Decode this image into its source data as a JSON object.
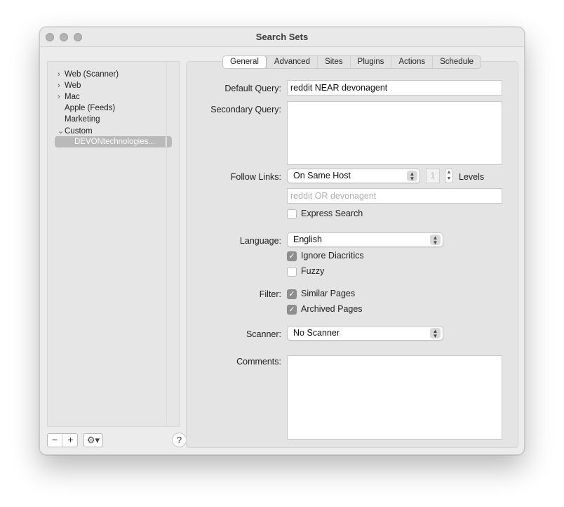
{
  "window": {
    "title": "Search Sets"
  },
  "sidebar": {
    "items": [
      {
        "label": "Web (Scanner)",
        "chevron": "›"
      },
      {
        "label": "Web",
        "chevron": "›"
      },
      {
        "label": "Mac",
        "chevron": "›"
      },
      {
        "label": "Apple (Feeds)",
        "chevron": ""
      },
      {
        "label": "Marketing",
        "chevron": ""
      },
      {
        "label": "Custom",
        "chevron": "⌄"
      }
    ],
    "selected": "DEVONtechnologies...",
    "buttons": {
      "minus": "−",
      "plus": "+",
      "gear": "⚙▾",
      "help": "?"
    }
  },
  "tabs": [
    "General",
    "Advanced",
    "Sites",
    "Plugins",
    "Actions",
    "Schedule"
  ],
  "form": {
    "default_query_label": "Default Query:",
    "default_query_value": "reddit NEAR devonagent",
    "secondary_query_label": "Secondary Query:",
    "follow_links_label": "Follow Links:",
    "follow_links_value": "On Same Host",
    "levels_value": "1",
    "levels_label": "Levels",
    "follow_filter_placeholder": "reddit OR devonagent",
    "express_search_label": "Express Search",
    "language_label": "Language:",
    "language_value": "English",
    "ignore_diacritics_label": "Ignore Diacritics",
    "fuzzy_label": "Fuzzy",
    "filter_label": "Filter:",
    "similar_pages_label": "Similar Pages",
    "archived_pages_label": "Archived Pages",
    "scanner_label": "Scanner:",
    "scanner_value": "No Scanner",
    "comments_label": "Comments:"
  },
  "checkboxes": {
    "express_search": false,
    "ignore_diacritics": true,
    "fuzzy": false,
    "similar_pages": true,
    "archived_pages": true
  }
}
